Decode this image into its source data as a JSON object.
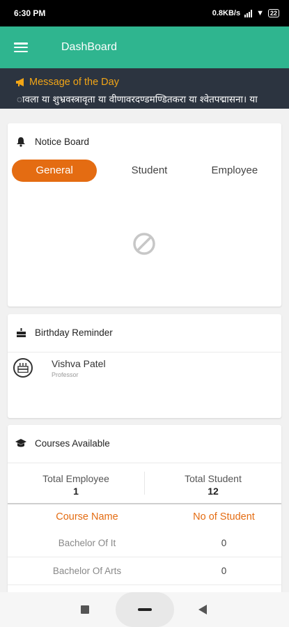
{
  "status": {
    "time": "6:30 PM",
    "speed": "0.8KB/s",
    "battery": "22"
  },
  "appbar": {
    "title": "DashBoard"
  },
  "motd": {
    "title": "Message of the Day",
    "text": "ावला या शुभ्रवस्त्रावृता या वीणावरदण्डमण्डितकरा या श्वेतपद्मासना। या"
  },
  "notice": {
    "title": "Notice Board",
    "tabs": [
      "General",
      "Student",
      "Employee"
    ],
    "active_tab": "General"
  },
  "birthday": {
    "title": "Birthday Reminder",
    "items": [
      {
        "name": "Vishva Patel",
        "role": "Professor"
      }
    ]
  },
  "courses": {
    "title": "Courses Available",
    "total_employee_label": "Total Employee",
    "total_employee": "1",
    "total_student_label": "Total Student",
    "total_student": "12",
    "columns": [
      "Course Name",
      "No of Student"
    ],
    "rows": [
      {
        "name": "Bachelor Of  It",
        "count": "0"
      },
      {
        "name": "Bachelor Of Arts",
        "count": "0"
      }
    ]
  },
  "colors": {
    "appbar": "#2fb58f",
    "accent": "#e46c12",
    "motd_bg": "#2c3440",
    "motd_title": "#f2a516"
  },
  "icons": [
    "menu-icon",
    "megaphone-icon",
    "bell-icon",
    "cake-icon",
    "graduation-cap-icon",
    "no-data-icon"
  ]
}
